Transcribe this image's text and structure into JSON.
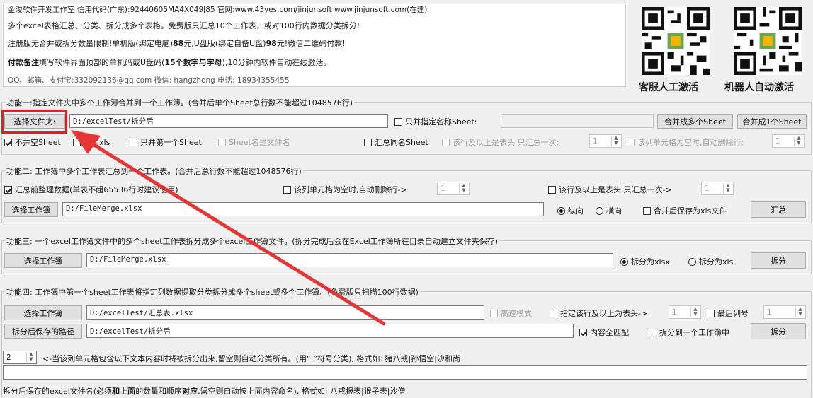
{
  "header": {
    "line1": "金浚软件开发工作室 信用代码(广东):92440605MA4X049J85 官网:www.43yes.com/jinjunsoft  www.jinjunsoft.com(在建)",
    "line2": "多个excel表格汇总、分类、拆分成多个表格。免费版只汇总10个工作表，或对100行内数据分类拆分!",
    "line3_a": "注册版无合并或拆分数量限制!单机版(绑定电脑)",
    "line3_b": "88",
    "line3_c": "元,U盘版(绑定自备U盘)",
    "line3_d": "98",
    "line3_e": "元!微信二维码付款!",
    "line4_a": "付款备注",
    "line4_b": "填写软件界面顶部的单机码或U盘码(",
    "line4_c": "15个数字与字母",
    "line4_d": "),10分钟内软件自动在线激活。",
    "line5": "QQ、邮箱、支付宝:332092136@qq.com  微信: hangzhong  电话: 18934355455",
    "qr_left_label": "客服人工激活",
    "qr_right_label": "机器人自动激活"
  },
  "func1": {
    "title": "功能一:指定文件夹中多个工作簿合并到一个工作簿。(合并后单个Sheet总行数不能超过1048576行)",
    "select_folder": "选择文件夹:",
    "folder_path": "D:/excelTest/拆分后",
    "only_merge_name": "只并指定名称Sheet:",
    "sheet_name_value": "",
    "merge_multi_btn": "合并成多个Sheet",
    "merge_one_btn": "合并成1个Sheet",
    "no_empty_sheet": "不并空Sheet",
    "save_xls": "存为xls",
    "only_first_sheet": "只并第一个Sheet",
    "sheet_name_is_file": "Sheet名是文件名",
    "summary_same_name": "汇总同名Sheet",
    "header_rows_label": "该行及以上是表头,只汇总一次:",
    "header_rows_value": "1",
    "empty_col_label": "该列单元格为空时,自动删除行:",
    "empty_col_value": "1"
  },
  "func2": {
    "title": "功能二: 工作簿中多个工作表汇总到一个工作表。(合并后总行数不能超过1048576行)",
    "pre_clean": "汇总前整理数据(单表不超65536行时建议使用)",
    "empty_col_label": "该列单元格为空时,自动删除行->",
    "empty_col_value": "1",
    "header_rows_label": "该行及以上是表头,只汇总一次->",
    "header_rows_value": "1",
    "select_workbook": "选择工作簿",
    "file_path": "D:/FileMerge.xlsx",
    "vertical": "纵向",
    "horizontal": "横向",
    "save_xls_after": "合并后保存为xls文件",
    "summary_btn": "汇总"
  },
  "func3": {
    "title": "功能三: 一个excel工作簿文件中的多个sheet工作表拆分成多个excel工作簿文件。(拆分完成后会在Excel工作簿所在目录自动建立文件夹保存)",
    "select_workbook": "选择工作簿",
    "file_path": "D:/FileMerge.xlsx",
    "split_xlsx": "拆分为xlsx",
    "split_xls": "拆分为xls",
    "split_btn": "拆分"
  },
  "func4": {
    "title": "功能四: 工作簿中第一个sheet工作表将指定列数据提取分类拆分成多个sheet或多个工作簿。(免费版只扫描100行数据)",
    "select_workbook": "选择工作簿",
    "file_path": "D:/excelTest/汇总表.xlsx",
    "fast_mode": "高速模式",
    "header_rows_label": "指定该行及以上为表头->",
    "header_rows_value": "1",
    "last_col_label": "最后列号",
    "last_col_value": "1",
    "save_path_btn": "拆分后保存的路径",
    "save_path": "D:/excelTest/拆分后",
    "full_match": "内容全匹配",
    "split_to_one": "拆分到一个工作簿中",
    "split_btn": "拆分",
    "col_value": "2",
    "col_hint": "<-当该列单元格包含以下文本内容时将被拆分出来,留空则自动分类所有。(用“|”符号分类), 格式如: 猪八戒|孙悟空|沙和尚",
    "filter_text": "",
    "filename_hint_a": "拆分后保存的excel文件名(必须",
    "filename_hint_b": "和上面",
    "filename_hint_c": "的数量和顺序",
    "filename_hint_d": "对应",
    "filename_hint_e": ",留空则自动按上面内容命名), 格式如: 八戒报表|猴子表|沙僧"
  },
  "colors": {
    "highlight": "#e02020",
    "arrow": "#e53535"
  }
}
